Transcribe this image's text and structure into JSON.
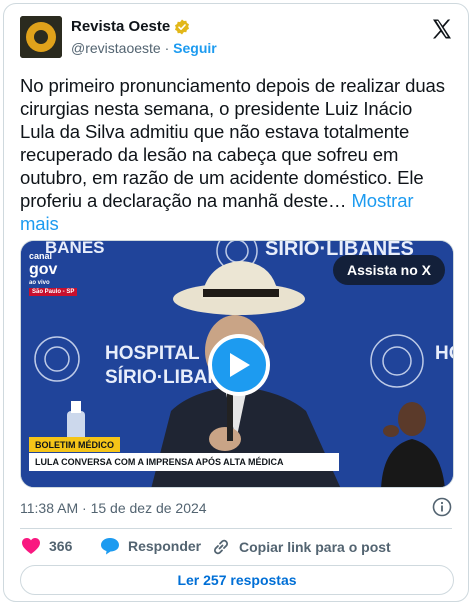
{
  "author": {
    "name": "Revista Oeste",
    "handle": "@revistaoeste",
    "separator": "·",
    "follow_label": "Seguir"
  },
  "post": {
    "text": "No primeiro pronunciamento depois de realizar duas cirurgias nesta semana, o presidente Luiz Inácio Lula da Silva admitiu que não estava totalmente recuperado da lesão na cabeça que sofreu em outubro, em razão de um acidente doméstico. Ele proferiu a declaração na manhã deste…",
    "show_more": "Mostrar mais"
  },
  "media": {
    "watch_label": "Assista no X",
    "backdrop_top": "SÍRIO·LIBANES",
    "backdrop_left": "BANES",
    "backdrop_center_1": "HOSPITAL",
    "backdrop_center_2": "SÍRIO·LIBAN",
    "backdrop_right": "HO SÍR",
    "broadcaster_top": "canal",
    "broadcaster_name": "gov",
    "broadcaster_live": "ao vivo",
    "broadcaster_location": "São Paulo - SP",
    "lower_third_tag": "BOLETIM MÉDICO",
    "lower_third_text": "LULA CONVERSA COM A IMPRENSA APÓS ALTA MÉDICA"
  },
  "meta": {
    "time": "11:38 AM",
    "date_sep": "·",
    "date": "15 de dez de 2024"
  },
  "actions": {
    "likes": "366",
    "reply_label": "Responder",
    "copy_label": "Copiar link para o post"
  },
  "replies_button": "Ler 257 respostas",
  "colors": {
    "accent": "#1d9bf0",
    "like": "#f91880",
    "muted": "#536471",
    "video_bg": "#1e3f91"
  }
}
